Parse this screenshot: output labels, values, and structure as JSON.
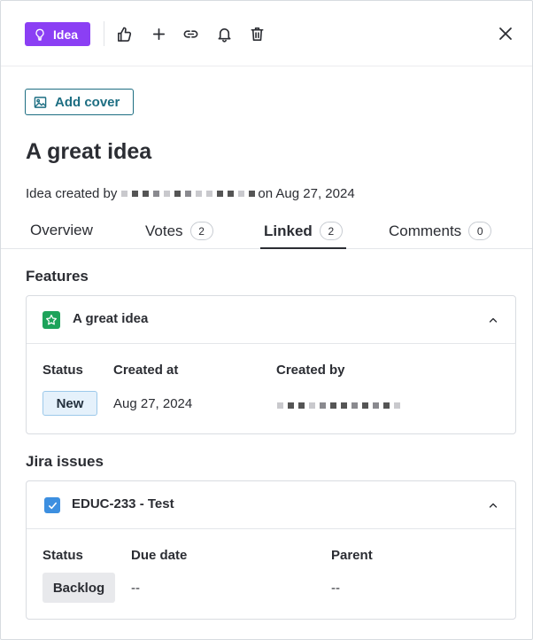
{
  "toolbar": {
    "idea_label": "Idea",
    "icons": [
      "lightbulb-icon",
      "thumbs-up-icon",
      "plus-icon",
      "link-icon",
      "bell-icon",
      "trash-icon",
      "close-icon"
    ],
    "accent": "#8b3ff4"
  },
  "cover": {
    "label": "Add cover"
  },
  "title": "A great idea",
  "meta": {
    "prefix": "Idea created by",
    "suffix": "on Aug 27, 2024"
  },
  "tabs": [
    {
      "label": "Overview",
      "count": null
    },
    {
      "label": "Votes",
      "count": "2"
    },
    {
      "label": "Linked",
      "count": "2",
      "active": true
    },
    {
      "label": "Comments",
      "count": "0"
    }
  ],
  "features": {
    "heading": "Features",
    "card": {
      "title": "A great idea",
      "icon_color": "#1ea35b",
      "status_label": "Status",
      "status_value": "New",
      "created_at_label": "Created at",
      "created_at_value": "Aug 27, 2024",
      "created_by_label": "Created by"
    }
  },
  "jira": {
    "heading": "Jira issues",
    "card": {
      "title": "EDUC-233 - Test",
      "icon_color": "#3d8fe0",
      "status_label": "Status",
      "status_value": "Backlog",
      "due_label": "Due date",
      "due_value": "--",
      "parent_label": "Parent",
      "parent_value": "--"
    }
  }
}
